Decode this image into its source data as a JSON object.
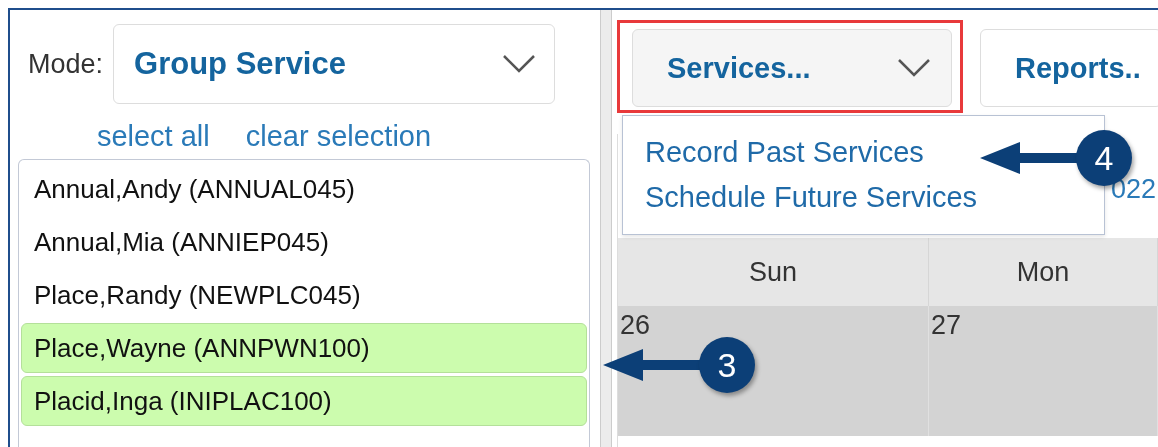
{
  "mode": {
    "label": "Mode:",
    "value": "Group Service"
  },
  "list_actions": [
    "select all",
    "clear selection"
  ],
  "clients": [
    {
      "name": "Annual,Andy (ANNUAL045)",
      "selected": false
    },
    {
      "name": "Annual,Mia (ANNIEP045)",
      "selected": false
    },
    {
      "name": "Place,Randy (NEWPLC045)",
      "selected": false
    },
    {
      "name": "Place,Wayne (ANNPWN100)",
      "selected": true
    },
    {
      "name": "Placid,Inga (INIPLAC100)",
      "selected": true
    }
  ],
  "toolbar": [
    {
      "label": "Services...",
      "highlighted": true,
      "expanded": true
    },
    {
      "label": "Reports..",
      "highlighted": false,
      "expanded": false
    }
  ],
  "services_menu": [
    {
      "label": "Record Past Services"
    },
    {
      "label": "Schedule Future Services"
    }
  ],
  "calendar": {
    "title": "022",
    "days": [
      "Sun",
      "Mon"
    ],
    "dates": [
      "26",
      "27"
    ]
  },
  "callouts": [
    {
      "number": "3"
    },
    {
      "number": "4"
    }
  ]
}
